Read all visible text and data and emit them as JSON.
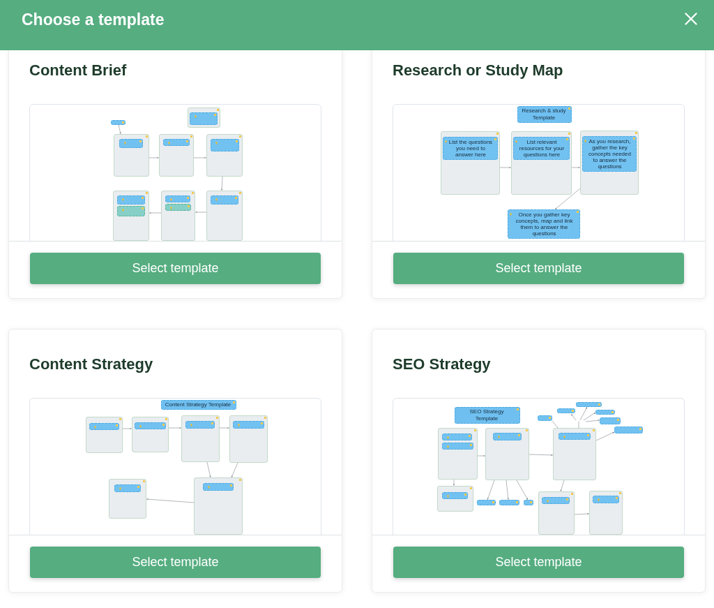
{
  "dialog": {
    "title": "Choose a template"
  },
  "templates": [
    {
      "name": "Content Brief",
      "button": "Select template"
    },
    {
      "name": "Research or Study Map",
      "button": "Select template",
      "preview": {
        "title": "Research & study Template",
        "notes": [
          "List the questions you need to answer here",
          "List relevant resources for your questions here",
          "As you research, gather the key concepts needed to answer the questions",
          "Once you gather key concepts, map and link them to answer the questions"
        ]
      }
    },
    {
      "name": "Content Strategy",
      "button": "Select template",
      "preview": {
        "title": "Content Strategy Template"
      }
    },
    {
      "name": "SEO Strategy",
      "button": "Select template",
      "preview": {
        "title": "SEO Strategy Template"
      }
    }
  ]
}
